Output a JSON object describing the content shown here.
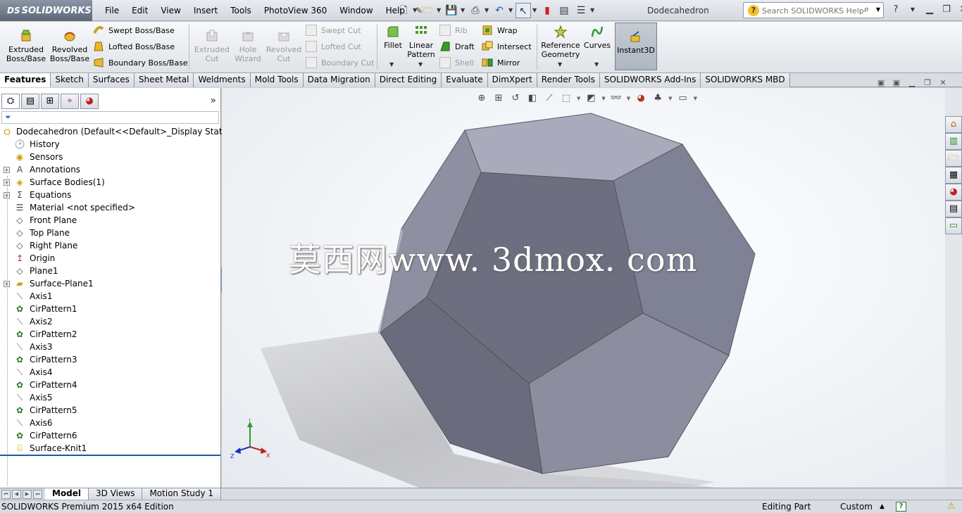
{
  "app": {
    "logo": "SOLIDWORKS",
    "document_title": "Dodecahedron"
  },
  "menu": [
    "File",
    "Edit",
    "View",
    "Insert",
    "Tools",
    "PhotoView 360",
    "Window",
    "Help"
  ],
  "search": {
    "placeholder": "Search SOLIDWORKS Help"
  },
  "ribbon": {
    "extruded_boss": "Extruded Boss/Base",
    "revolved_boss": "Revolved Boss/Base",
    "swept_boss": "Swept Boss/Base",
    "lofted_boss": "Lofted Boss/Base",
    "boundary_boss": "Boundary Boss/Base",
    "extruded_cut": "Extruded Cut",
    "hole_wizard": "Hole Wizard",
    "revolved_cut": "Revolved Cut",
    "swept_cut": "Swept Cut",
    "lofted_cut": "Lofted Cut",
    "boundary_cut": "Boundary Cut",
    "fillet": "Fillet",
    "linear_pattern": "Linear Pattern",
    "rib": "Rib",
    "draft": "Draft",
    "shell": "Shell",
    "wrap": "Wrap",
    "intersect": "Intersect",
    "mirror": "Mirror",
    "reference_geometry": "Reference Geometry",
    "curves": "Curves",
    "instant3d": "Instant3D"
  },
  "tabs": [
    "Features",
    "Sketch",
    "Surfaces",
    "Sheet Metal",
    "Weldments",
    "Mold Tools",
    "Data Migration",
    "Direct Editing",
    "Evaluate",
    "DimXpert",
    "Render Tools",
    "SOLIDWORKS Add-Ins",
    "SOLIDWORKS MBD"
  ],
  "tree": {
    "root": "Dodecahedron  (Default<<Default>_Display State 1>)",
    "items": [
      {
        "label": "History",
        "icon": "history-icon",
        "expandable": false
      },
      {
        "label": "Sensors",
        "icon": "sensor-icon",
        "expandable": false
      },
      {
        "label": "Annotations",
        "icon": "annotation-icon",
        "expandable": true
      },
      {
        "label": "Surface Bodies(1)",
        "icon": "surface-bodies-icon",
        "expandable": true
      },
      {
        "label": "Equations",
        "icon": "equation-icon",
        "expandable": true
      },
      {
        "label": "Material <not specified>",
        "icon": "material-icon",
        "expandable": false
      },
      {
        "label": "Front Plane",
        "icon": "plane-icon",
        "expandable": false
      },
      {
        "label": "Top Plane",
        "icon": "plane-icon",
        "expandable": false
      },
      {
        "label": "Right Plane",
        "icon": "plane-icon",
        "expandable": false
      },
      {
        "label": "Origin",
        "icon": "origin-icon",
        "expandable": false
      },
      {
        "label": "Plane1",
        "icon": "plane-icon",
        "expandable": false
      },
      {
        "label": "Surface-Plane1",
        "icon": "surface-plane-icon",
        "expandable": true
      },
      {
        "label": "Axis1",
        "icon": "axis-icon",
        "expandable": false
      },
      {
        "label": "CirPattern1",
        "icon": "circular-pattern-icon",
        "expandable": false
      },
      {
        "label": "Axis2",
        "icon": "axis-icon",
        "expandable": false
      },
      {
        "label": "CirPattern2",
        "icon": "circular-pattern-icon",
        "expandable": false
      },
      {
        "label": "Axis3",
        "icon": "axis-icon",
        "expandable": false
      },
      {
        "label": "CirPattern3",
        "icon": "circular-pattern-icon",
        "expandable": false
      },
      {
        "label": "Axis4",
        "icon": "axis-icon",
        "expandable": false
      },
      {
        "label": "CirPattern4",
        "icon": "circular-pattern-icon",
        "expandable": false
      },
      {
        "label": "Axis5",
        "icon": "axis-icon",
        "expandable": false
      },
      {
        "label": "CirPattern5",
        "icon": "circular-pattern-icon",
        "expandable": false
      },
      {
        "label": "Axis6",
        "icon": "axis-icon",
        "expandable": false
      },
      {
        "label": "CirPattern6",
        "icon": "circular-pattern-icon",
        "expandable": false
      },
      {
        "label": "Surface-Knit1",
        "icon": "surface-knit-icon",
        "expandable": false
      }
    ]
  },
  "watermark": "莫西网www. 3dmox. com",
  "triad": {
    "x": "X",
    "y": "Y",
    "z": "Z"
  },
  "bottom_tabs": [
    "Model",
    "3D Views",
    "Motion Study 1"
  ],
  "status": {
    "edition": "SOLIDWORKS Premium 2015 x64 Edition",
    "mode": "Editing Part",
    "units": "Custom",
    "help": "?"
  },
  "colors": {
    "accent": "#1c5aa0",
    "face_light": "#a6a8ba",
    "face_dark": "#6b6d80"
  }
}
